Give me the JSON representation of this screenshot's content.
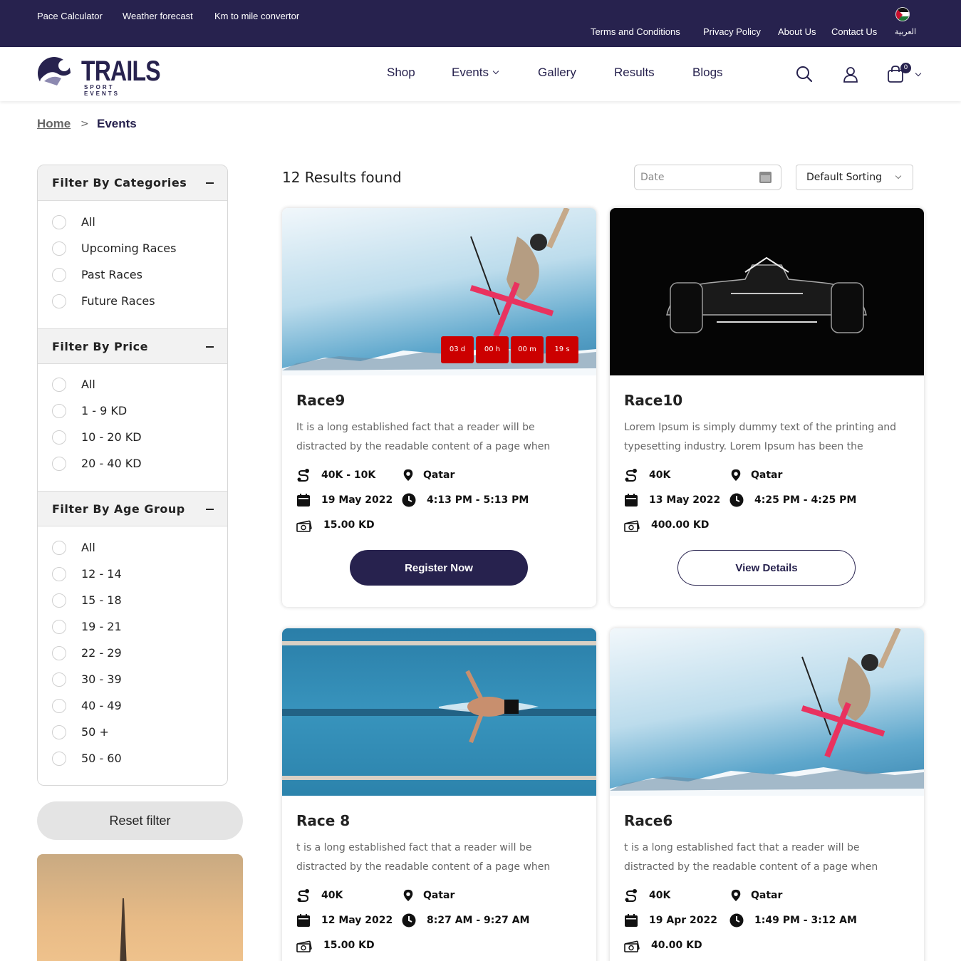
{
  "topbar": {
    "left_links": [
      "Pace Calculator",
      "Weather forecast",
      "Km to mile convertor"
    ],
    "right_links": [
      "Terms and Conditions",
      "Privacy Policy",
      "About Us",
      "Contact Us"
    ],
    "language": "العربية"
  },
  "logo": {
    "name": "TRAILS",
    "tagline": "SPORT EVENTS"
  },
  "nav": {
    "items": [
      "Shop",
      "Events",
      "Gallery",
      "Results",
      "Blogs"
    ],
    "cart_count": "0"
  },
  "breadcrumb": {
    "home": "Home",
    "separator": ">",
    "current": "Events"
  },
  "filters": {
    "categories": {
      "title": "Filter By Categories",
      "options": [
        "All",
        "Upcoming Races",
        "Past Races",
        "Future Races"
      ]
    },
    "price": {
      "title": "Filter By Price",
      "options": [
        "All",
        "1 - 9 KD",
        "10 - 20 KD",
        "20 - 40 KD"
      ]
    },
    "age": {
      "title": "Filter By Age Group",
      "options": [
        "All",
        "12 - 14",
        "15 - 18",
        "19 - 21",
        "22 - 29",
        "30 - 39",
        "40 - 49",
        "50 +",
        "50 - 60"
      ]
    },
    "reset_label": "Reset filter"
  },
  "results": {
    "count_text": "12 Results found",
    "date_placeholder": "Date",
    "sort_value": "Default Sorting"
  },
  "events": [
    {
      "title": "Race9",
      "desc": "It is a long established fact that a reader will be distracted by the readable content of a page when looking at its layout....",
      "distance": "40K - 10K",
      "location": "Qatar",
      "date": "19 May 2022",
      "time": "4:13 PM - 5:13 PM",
      "price": "15.00 KD",
      "button": "Register Now",
      "countdown": [
        "03 d",
        "00 h",
        "00 m",
        "19 s"
      ]
    },
    {
      "title": "Race10",
      "desc": "Lorem Ipsum is simply dummy text of the printing and typesetting industry. Lorem Ipsum has been the industry's...",
      "distance": "40K",
      "location": "Qatar",
      "date": "13 May 2022",
      "time": "4:25 PM - 4:25 PM",
      "price": "400.00 KD",
      "button": "View Details"
    },
    {
      "title": "Race 8",
      "desc": "t is a long established fact that a reader will be distracted by the readable content of a page when looking at its layout....",
      "distance": "40K",
      "location": "Qatar",
      "date": "12 May 2022",
      "time": "8:27 AM - 9:27 AM",
      "price": "15.00 KD"
    },
    {
      "title": "Race6",
      "desc": "t is a long established fact that a reader will be distracted by the readable content of a page when looking at its layout....",
      "distance": "40K",
      "location": "Qatar",
      "date": "19 Apr 2022",
      "time": "1:49 PM - 3:12 AM",
      "price": "40.00 KD"
    }
  ],
  "colors": {
    "brand": "#27224e",
    "countdown": "#cc0000"
  }
}
